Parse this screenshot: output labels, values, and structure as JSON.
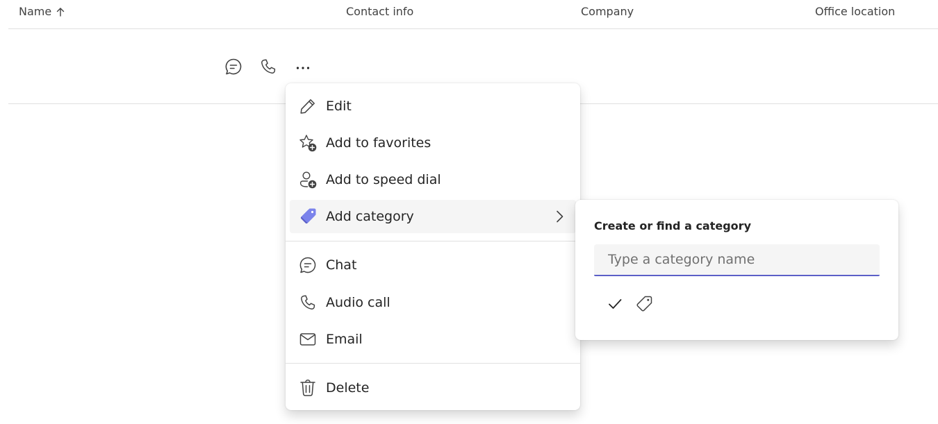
{
  "table": {
    "columns": {
      "name": "Name",
      "contact_info": "Contact info",
      "company": "Company",
      "office_location": "Office location"
    },
    "sort_icon": "arrow-up-icon",
    "row_actions": [
      "chat-icon",
      "call-icon",
      "more-options-icon"
    ]
  },
  "context_menu": {
    "items": [
      {
        "label": "Edit",
        "icon": "pencil-icon"
      },
      {
        "label": "Add to favorites",
        "icon": "star-add-icon"
      },
      {
        "label": "Add to speed dial",
        "icon": "person-add-icon"
      },
      {
        "label": "Add category",
        "icon": "tag-icon",
        "has_submenu": true,
        "highlighted": true
      },
      {
        "label": "Chat",
        "icon": "chat-icon"
      },
      {
        "label": "Audio call",
        "icon": "call-icon"
      },
      {
        "label": "Email",
        "icon": "mail-icon"
      },
      {
        "label": "Delete",
        "icon": "trash-icon"
      }
    ]
  },
  "category_submenu": {
    "title": "Create or find a category",
    "input_placeholder": "Type a category name",
    "input_value": "",
    "actions": [
      "checkmark-icon",
      "tag-outline-icon"
    ]
  },
  "colors": {
    "accent": "#5b5fc7",
    "category_tag": "#7b83eb",
    "text": "#242424",
    "divider": "#e0e0e0",
    "hover": "#f5f5f5"
  }
}
